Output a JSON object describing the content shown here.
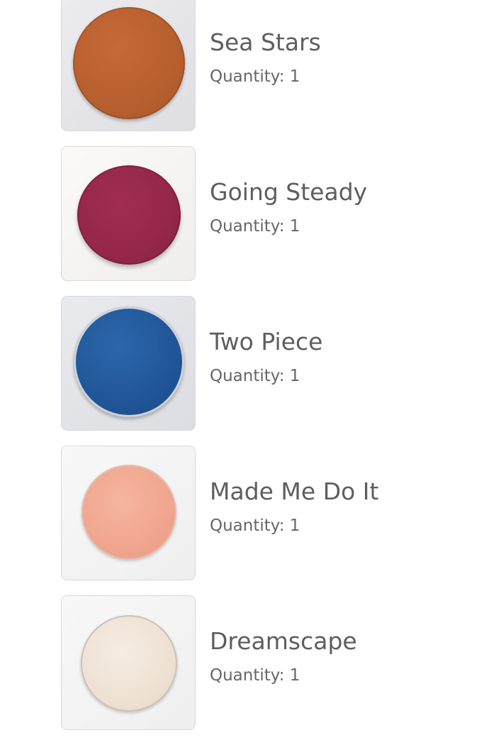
{
  "quantity_label": "Quantity:",
  "products": [
    {
      "name": "Sea Stars",
      "quantity": "1",
      "shade_color": "#b8602f",
      "backdrop_color": "#e6e6e9"
    },
    {
      "name": "Going Steady",
      "quantity": "1",
      "shade_color": "#95274a",
      "backdrop_color": "#f7f6f4"
    },
    {
      "name": "Two Piece",
      "quantity": "1",
      "shade_color": "#21589a",
      "backdrop_color": "#e4e5ea"
    },
    {
      "name": "Made Me Do It",
      "quantity": "1",
      "shade_color": "#f1a78f",
      "backdrop_color": "#f5f5f5"
    },
    {
      "name": "Dreamscape",
      "quantity": "1",
      "shade_color": "#efe2d4",
      "backdrop_color": "#f5f5f5"
    }
  ]
}
